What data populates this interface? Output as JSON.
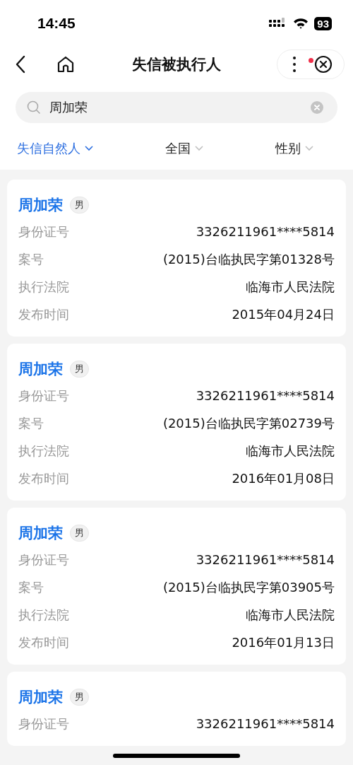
{
  "status_bar": {
    "time": "14:45",
    "battery": "93"
  },
  "nav": {
    "title": "失信被执行人",
    "notification_dot": true
  },
  "search": {
    "value": "周加荣"
  },
  "filters": [
    {
      "label": "失信自然人",
      "selected": true
    },
    {
      "label": "全国",
      "selected": false
    },
    {
      "label": "性别",
      "selected": false
    }
  ],
  "results": [
    {
      "name": "周加荣",
      "gender": "男",
      "fields": [
        {
          "label": "身份证号",
          "value": "3326211961****5814"
        },
        {
          "label": "案号",
          "value": "(2015)台临执民字第01328号"
        },
        {
          "label": "执行法院",
          "value": "临海市人民法院"
        },
        {
          "label": "发布时间",
          "value": "2015年04月24日"
        }
      ]
    },
    {
      "name": "周加荣",
      "gender": "男",
      "fields": [
        {
          "label": "身份证号",
          "value": "3326211961****5814"
        },
        {
          "label": "案号",
          "value": "(2015)台临执民字第02739号"
        },
        {
          "label": "执行法院",
          "value": "临海市人民法院"
        },
        {
          "label": "发布时间",
          "value": "2016年01月08日"
        }
      ]
    },
    {
      "name": "周加荣",
      "gender": "男",
      "fields": [
        {
          "label": "身份证号",
          "value": "3326211961****5814"
        },
        {
          "label": "案号",
          "value": "(2015)台临执民字第03905号"
        },
        {
          "label": "执行法院",
          "value": "临海市人民法院"
        },
        {
          "label": "发布时间",
          "value": "2016年01月13日"
        }
      ]
    },
    {
      "name": "周加荣",
      "gender": "男",
      "fields": [
        {
          "label": "身份证号",
          "value": "3326211961****5814"
        }
      ]
    }
  ]
}
